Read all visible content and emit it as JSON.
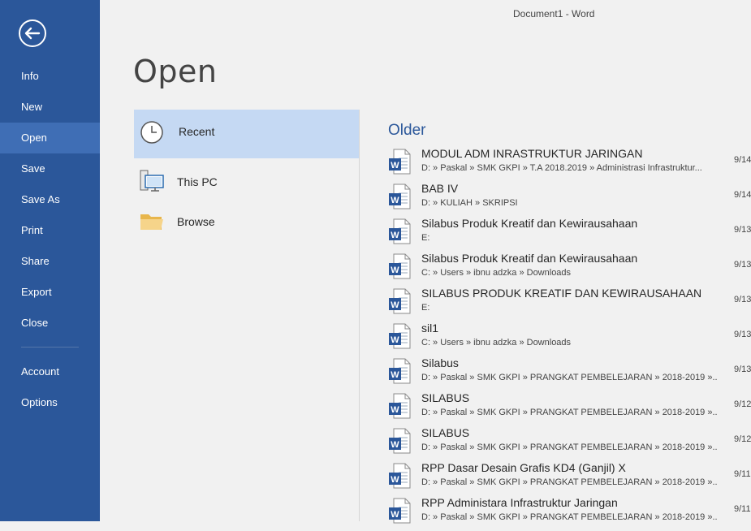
{
  "window": {
    "title": "Document1 - Word"
  },
  "sidebar": {
    "items": [
      {
        "label": "Info"
      },
      {
        "label": "New"
      },
      {
        "label": "Open"
      },
      {
        "label": "Save"
      },
      {
        "label": "Save As"
      },
      {
        "label": "Print"
      },
      {
        "label": "Share"
      },
      {
        "label": "Export"
      },
      {
        "label": "Close"
      },
      {
        "label": "Account"
      },
      {
        "label": "Options"
      }
    ]
  },
  "page": {
    "heading": "Open"
  },
  "places": [
    {
      "label": "Recent",
      "icon": "clock-icon"
    },
    {
      "label": "This PC",
      "icon": "computer-icon"
    },
    {
      "label": "Browse",
      "icon": "folder-icon"
    }
  ],
  "recent": {
    "section": "Older",
    "docs": [
      {
        "name": "MODUL ADM INRASTRUKTUR JARINGAN",
        "path": "D: » Paskal » SMK GKPI » T.A 2018.2019 » Administrasi Infrastruktur...",
        "date": "9/14"
      },
      {
        "name": "BAB IV",
        "path": "D: » KULIAH » SKRIPSI",
        "date": "9/14"
      },
      {
        "name": "Silabus Produk Kreatif dan Kewirausahaan",
        "path": "E:",
        "date": "9/13"
      },
      {
        "name": "Silabus Produk Kreatif dan Kewirausahaan",
        "path": "C: » Users » ibnu adzka » Downloads",
        "date": "9/13"
      },
      {
        "name": "SILABUS PRODUK KREATIF DAN KEWIRAUSAHAAN",
        "path": "E:",
        "date": "9/13"
      },
      {
        "name": "sil1",
        "path": "C: » Users » ibnu adzka » Downloads",
        "date": "9/13"
      },
      {
        "name": "Silabus",
        "path": "D: » Paskal » SMK GKPI » PRANGKAT PEMBELEJARAN » 2018-2019 »...",
        "date": "9/13"
      },
      {
        "name": "SILABUS",
        "path": "D: » Paskal » SMK GKPI » PRANGKAT PEMBELEJARAN » 2018-2019 »...",
        "date": "9/12"
      },
      {
        "name": "SILABUS",
        "path": "D: » Paskal » SMK GKPI » PRANGKAT PEMBELEJARAN » 2018-2019 »...",
        "date": "9/12"
      },
      {
        "name": "RPP Dasar Desain Grafis KD4 (Ganjil) X",
        "path": "D: » Paskal » SMK GKPI » PRANGKAT PEMBELEJARAN » 2018-2019 »...",
        "date": "9/11"
      },
      {
        "name": "RPP Administara Infrastruktur Jaringan",
        "path": "D: » Paskal » SMK GKPI » PRANGKAT PEMBELEJARAN » 2018-2019 »...",
        "date": "9/11"
      }
    ]
  },
  "colors": {
    "accent": "#2b579a",
    "selected": "#c5d9f3",
    "active_nav": "#3f6eb5"
  }
}
